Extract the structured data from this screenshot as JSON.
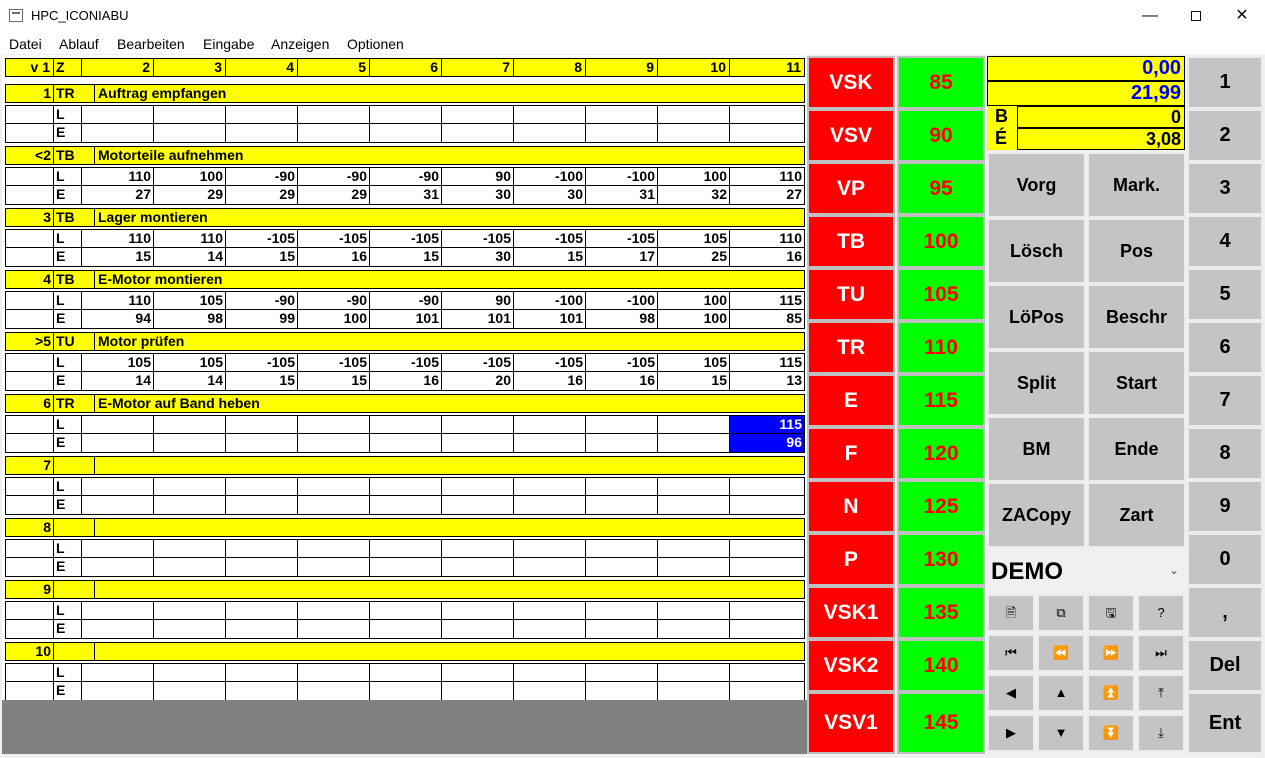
{
  "window": {
    "title": "HPC_ICONIABU",
    "min": "—",
    "close": "✕"
  },
  "menu": [
    "Datei",
    "Ablauf",
    "Bearbeiten",
    "Eingabe",
    "Anzeigen",
    "Optionen"
  ],
  "header": {
    "a": "v 1",
    "z": "Z",
    "cols": [
      "2",
      "3",
      "4",
      "5",
      "6",
      "7",
      "8",
      "9",
      "10",
      "11"
    ]
  },
  "rows": [
    {
      "num": "1",
      "z": "TR",
      "desc": "Auftrag empfangen",
      "L": [
        "",
        "",
        "",
        "",
        "",
        "",
        "",
        "",
        "",
        ""
      ],
      "E": [
        "",
        "",
        "",
        "",
        "",
        "",
        "",
        "",
        "",
        ""
      ]
    },
    {
      "num": "<2",
      "z": "TB",
      "desc": "Motorteile aufnehmen",
      "L": [
        "110",
        "100",
        "-90",
        "-90",
        "-90",
        "90",
        "-100",
        "-100",
        "100",
        "110"
      ],
      "E": [
        "27",
        "29",
        "29",
        "29",
        "31",
        "30",
        "30",
        "31",
        "32",
        "27"
      ]
    },
    {
      "num": "3",
      "z": "TB",
      "desc": "Lager montieren",
      "L": [
        "110",
        "110",
        "-105",
        "-105",
        "-105",
        "-105",
        "-105",
        "-105",
        "105",
        "110"
      ],
      "E": [
        "15",
        "14",
        "15",
        "16",
        "15",
        "30",
        "15",
        "17",
        "25",
        "16"
      ]
    },
    {
      "num": "4",
      "z": "TB",
      "desc": "E-Motor montieren",
      "L": [
        "110",
        "105",
        "-90",
        "-90",
        "-90",
        "90",
        "-100",
        "-100",
        "100",
        "115"
      ],
      "E": [
        "94",
        "98",
        "99",
        "100",
        "101",
        "101",
        "101",
        "98",
        "100",
        "85"
      ]
    },
    {
      "num": ">5",
      "z": "TU",
      "desc": "Motor prüfen",
      "L": [
        "105",
        "105",
        "-105",
        "-105",
        "-105",
        "-105",
        "-105",
        "-105",
        "105",
        "115"
      ],
      "E": [
        "14",
        "14",
        "15",
        "15",
        "16",
        "20",
        "16",
        "16",
        "15",
        "13"
      ]
    },
    {
      "num": "6",
      "z": "TR",
      "desc": "E-Motor auf Band heben",
      "L": [
        "",
        "",
        "",
        "",
        "",
        "",
        "",
        "",
        "",
        "115"
      ],
      "E": [
        "",
        "",
        "",
        "",
        "",
        "",
        "",
        "",
        "",
        "96"
      ]
    },
    {
      "num": "7",
      "z": "",
      "desc": "",
      "L": [
        "",
        "",
        "",
        "",
        "",
        "",
        "",
        "",
        "",
        ""
      ],
      "E": [
        "",
        "",
        "",
        "",
        "",
        "",
        "",
        "",
        "",
        ""
      ]
    },
    {
      "num": "8",
      "z": "",
      "desc": "",
      "L": [
        "",
        "",
        "",
        "",
        "",
        "",
        "",
        "",
        "",
        ""
      ],
      "E": [
        "",
        "",
        "",
        "",
        "",
        "",
        "",
        "",
        "",
        ""
      ]
    },
    {
      "num": "9",
      "z": "",
      "desc": "",
      "L": [
        "",
        "",
        "",
        "",
        "",
        "",
        "",
        "",
        "",
        ""
      ],
      "E": [
        "",
        "",
        "",
        "",
        "",
        "",
        "",
        "",
        "",
        ""
      ]
    },
    {
      "num": "10",
      "z": "",
      "desc": "",
      "L": [
        "",
        "",
        "",
        "",
        "",
        "",
        "",
        "",
        "",
        ""
      ],
      "E": [
        "",
        "",
        "",
        "",
        "",
        "",
        "",
        "",
        "",
        ""
      ]
    }
  ],
  "line_labels": {
    "L": "L",
    "E": "E"
  },
  "red_buttons": [
    "VSK",
    "VSV",
    "VP",
    "TB",
    "TU",
    "TR",
    "E",
    "F",
    "N",
    "P",
    "VSK1",
    "VSK2",
    "VSV1"
  ],
  "green_values": [
    "85",
    "90",
    "95",
    "100",
    "105",
    "110",
    "115",
    "120",
    "125",
    "130",
    "135",
    "140",
    "145"
  ],
  "display": {
    "top": "0,00",
    "second": "21,99",
    "b_label": "B",
    "b_value": "0",
    "e_label": "É",
    "e_value": "3,08"
  },
  "func_buttons": [
    "Vorg",
    "Mark.",
    "Lösch",
    "Pos",
    "LöPos",
    "Beschr",
    "Split",
    "Start",
    "BM",
    "Ende",
    "ZACopy",
    "Zart"
  ],
  "dropdown": {
    "value": "DEMO",
    "chevron": "⌄"
  },
  "icon_buttons": [
    {
      "name": "new-file-icon",
      "glyph": "🗎"
    },
    {
      "name": "copy-icon",
      "glyph": "⧉"
    },
    {
      "name": "save-icon",
      "glyph": "🖫"
    },
    {
      "name": "help-icon",
      "glyph": "?"
    },
    {
      "name": "first-icon",
      "glyph": "⏮"
    },
    {
      "name": "rewind-icon",
      "glyph": "⏪"
    },
    {
      "name": "fast-forward-icon",
      "glyph": "⏩"
    },
    {
      "name": "last-icon",
      "glyph": "⏭"
    },
    {
      "name": "left-arrow-icon",
      "glyph": "◀"
    },
    {
      "name": "up-arrow-icon",
      "glyph": "▲"
    },
    {
      "name": "double-up-arrow-icon",
      "glyph": "⏫"
    },
    {
      "name": "top-arrow-icon",
      "glyph": "⤒"
    },
    {
      "name": "right-arrow-icon",
      "glyph": "▶"
    },
    {
      "name": "down-arrow-icon",
      "glyph": "▼"
    },
    {
      "name": "double-down-arrow-icon",
      "glyph": "⏬"
    },
    {
      "name": "bottom-arrow-icon",
      "glyph": "⤓"
    }
  ],
  "num_buttons": [
    "1",
    "2",
    "3",
    "4",
    "5",
    "6",
    "7",
    "8",
    "9",
    "0",
    ",",
    "Del",
    "Ent"
  ]
}
